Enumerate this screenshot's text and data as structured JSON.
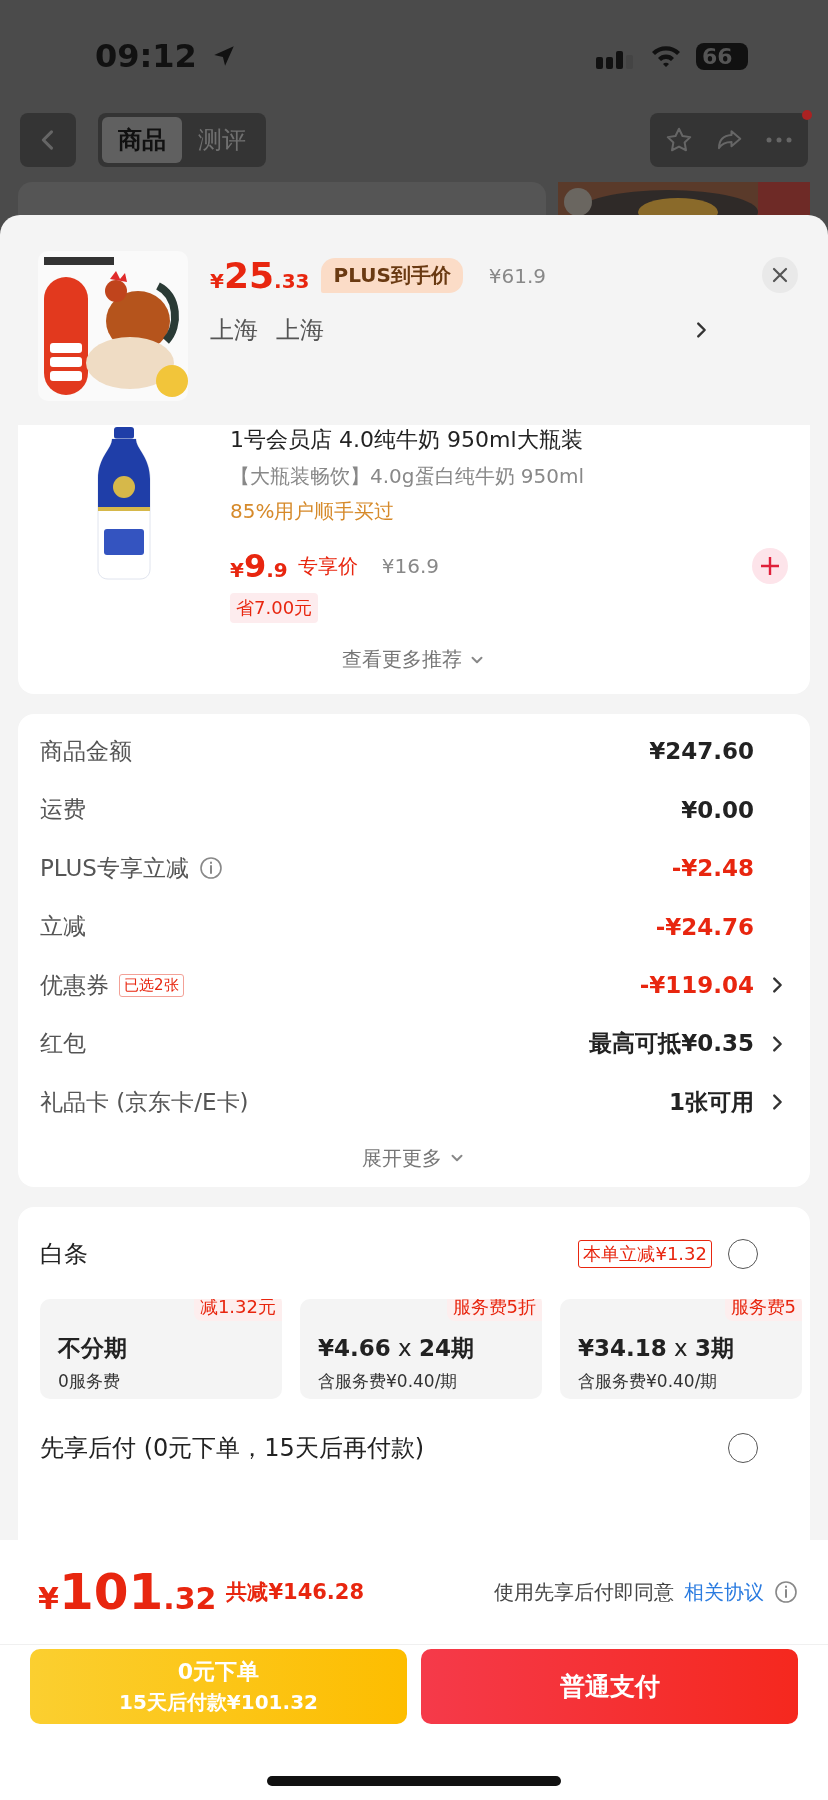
{
  "status_bar": {
    "time": "09:12",
    "battery": "66"
  },
  "nav": {
    "tabs": [
      {
        "label": "商品",
        "selected": true
      },
      {
        "label": "测评",
        "selected": false
      }
    ]
  },
  "sku_header": {
    "price_symbol": "¥",
    "price_int": "25",
    "price_dec": ".33",
    "price_tag": "PLUS到手价",
    "original_price": "¥61.9",
    "location": [
      "上海",
      "上海"
    ]
  },
  "recommendation": {
    "title": "1号会员店 4.0纯牛奶 950ml大瓶装",
    "subtitle": "【大瓶装畅饮】4.0g蛋白纯牛奶 950ml",
    "social_proof": "85%用户顺手买过",
    "price_symbol": "¥",
    "price_int": "9",
    "price_dec": ".9",
    "price_tag": "专享价",
    "original_price": "¥16.9",
    "saving": "省7.00元",
    "more": "查看更多推荐"
  },
  "summary": {
    "rows": [
      {
        "label": "商品金额",
        "value": "¥247.60",
        "kind": "normal",
        "arrow": false
      },
      {
        "label": "运费",
        "value": "¥0.00",
        "kind": "normal",
        "arrow": false
      },
      {
        "label": "PLUS专享立减",
        "info": true,
        "value": "-¥2.48",
        "kind": "discount",
        "arrow": false
      },
      {
        "label": "立减",
        "value": "-¥24.76",
        "kind": "discount",
        "arrow": false
      },
      {
        "label": "优惠券",
        "badge": "已选2张",
        "value": "-¥119.04",
        "kind": "discount",
        "arrow": true
      },
      {
        "label": "红包",
        "value": "最高可抵¥0.35",
        "kind": "normal",
        "arrow": true
      },
      {
        "label": "礼品卡 (京东卡/E卡)",
        "value": "1张可用",
        "kind": "normal",
        "arrow": true
      }
    ],
    "more": "展开更多"
  },
  "payment": {
    "baitiao": {
      "label": "白条",
      "promo": "本单立减¥1.32",
      "selected": false
    },
    "plans": [
      {
        "tag": "减1.32元",
        "title": "不分期",
        "note": "0服务费"
      },
      {
        "tag": "服务费5折",
        "title": "**¥4.66** x **24期**",
        "note": "含服务费¥0.40/期"
      },
      {
        "tag": "服务费5",
        "title": "**¥34.18** x **3期**",
        "note": "含服务费¥0.40/期"
      }
    ],
    "later": {
      "label": "先享后付 (0元下单，15天后再付款)",
      "selected": false
    }
  },
  "footer": {
    "total_symbol": "¥",
    "total_int": "101",
    "total_dec": ".32",
    "total_saving": "共减¥146.28",
    "agreement": "使用先享后付即同意",
    "agreement_link": "相关协议",
    "buttons": [
      {
        "kind": "later",
        "line1": "0元下单",
        "line2": "15天后付款¥101.32"
      },
      {
        "kind": "pay",
        "line1": "普通支付"
      }
    ]
  }
}
